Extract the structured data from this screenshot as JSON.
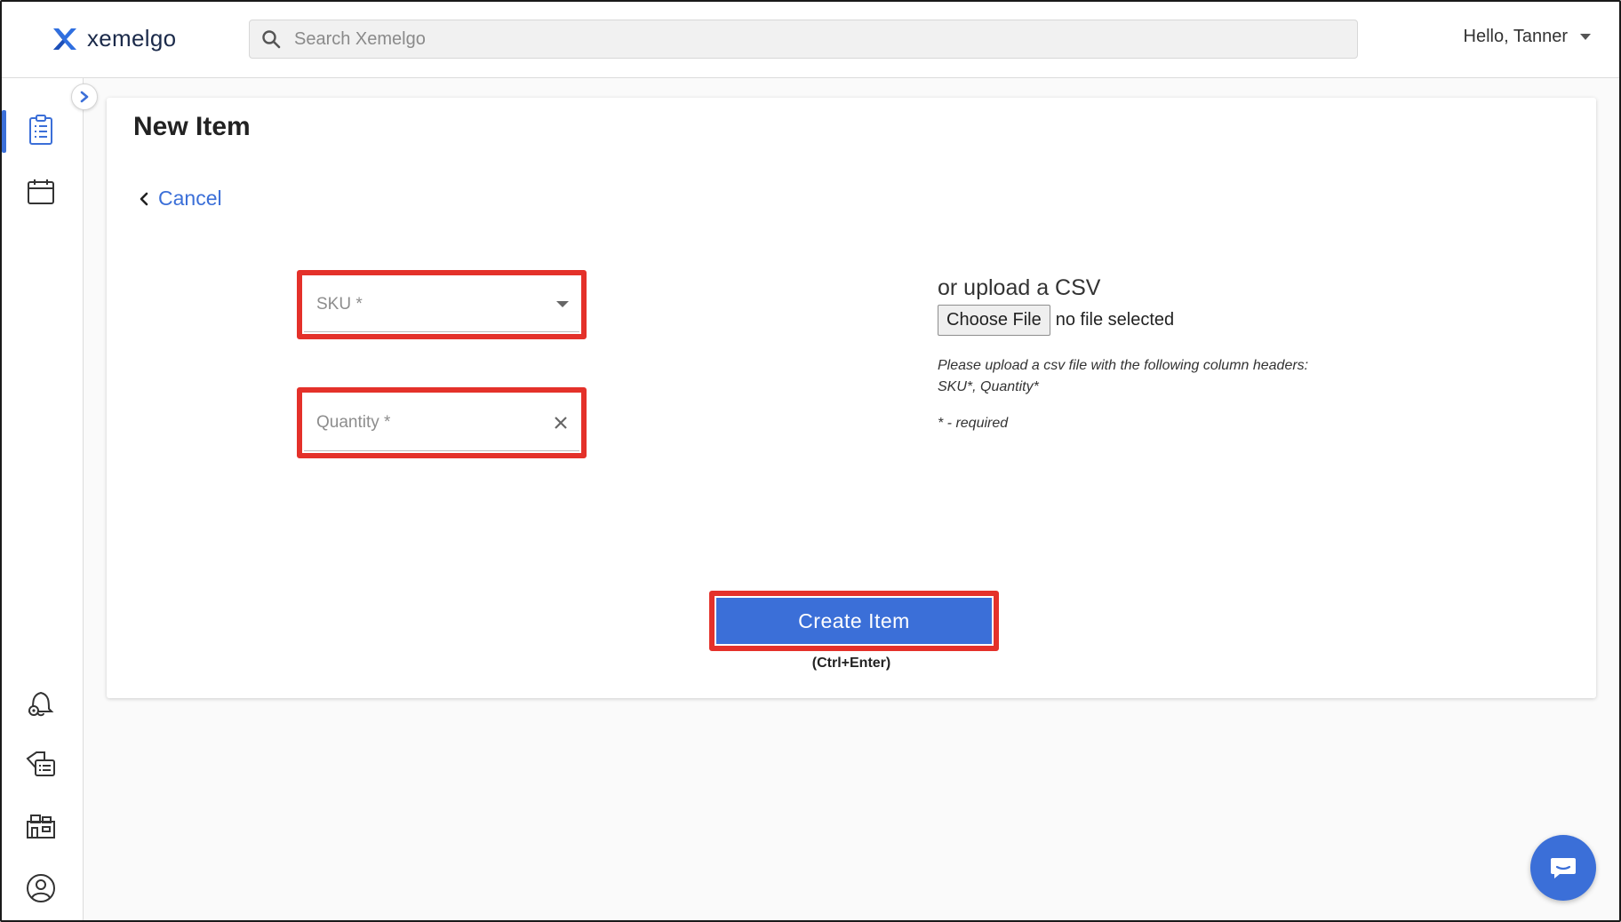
{
  "header": {
    "brand": "xemelgo",
    "search_placeholder": "Search Xemelgo",
    "greeting": "Hello, Tanner"
  },
  "sidebar": {
    "items": [
      {
        "icon": "clipboard-list-icon",
        "active": true
      },
      {
        "icon": "calendar-icon",
        "active": false
      },
      {
        "icon": "bell-gear-icon",
        "active": false
      },
      {
        "icon": "tag-list-icon",
        "active": false
      },
      {
        "icon": "building-icon",
        "active": false
      },
      {
        "icon": "user-circle-icon",
        "active": false
      }
    ]
  },
  "page": {
    "title": "New Item",
    "cancel_label": "Cancel"
  },
  "form": {
    "sku_placeholder": "SKU *",
    "quantity_placeholder": "Quantity *"
  },
  "upload": {
    "title": "or upload a CSV",
    "choose_label": "Choose File",
    "file_status": "no file selected",
    "hint_line1": "Please upload a csv file with the following column headers:",
    "hint_line2": "SKU*, Quantity*",
    "required_note": "* - required"
  },
  "actions": {
    "create_label": "Create Item",
    "shortcut_label": "(Ctrl+Enter)"
  },
  "colors": {
    "accent": "#3b6fd8",
    "highlight": "#e4312a"
  }
}
